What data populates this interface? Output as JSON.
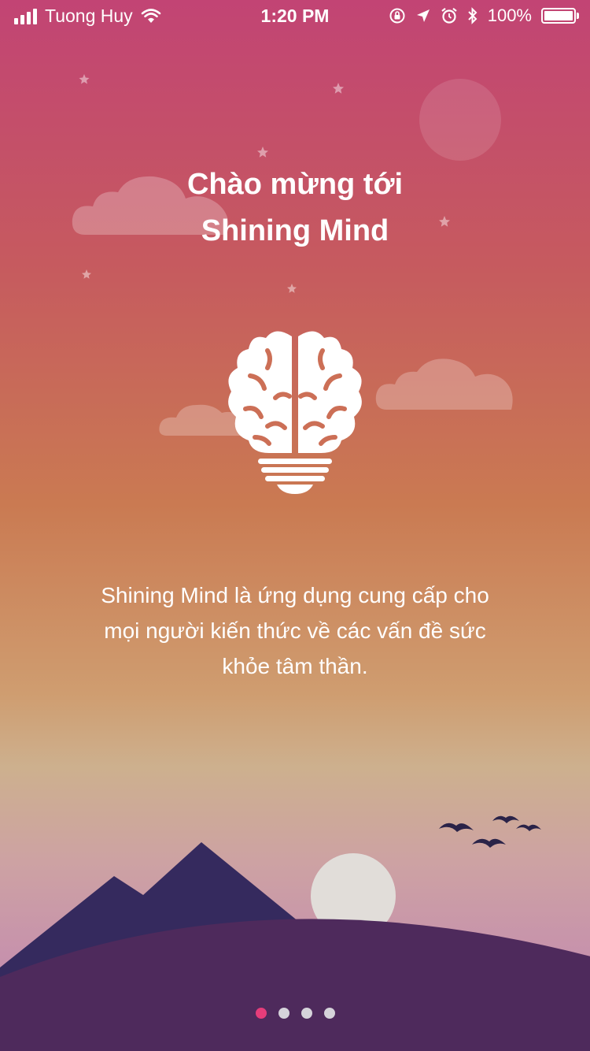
{
  "status_bar": {
    "carrier": "Tuong Huy",
    "time": "1:20 PM",
    "battery_percent": "100%",
    "battery_level": 1.0,
    "icons": [
      "signal-icon",
      "wifi-icon",
      "rotation-lock-icon",
      "location-icon",
      "alarm-icon",
      "bluetooth-icon",
      "battery-icon"
    ]
  },
  "onboarding": {
    "title_line1": "Chào mừng tới",
    "title_line2": "Shining Mind",
    "description_line1": "Shining Mind là ứng dụng cung cấp cho",
    "description_line2": "mọi người kiến thức về các vấn đề sức",
    "description_line3": "khỏe tâm thần.",
    "illustration_icon": "brain-lightbulb-icon"
  },
  "pagination": {
    "total": 4,
    "active_index": 0
  },
  "colors": {
    "gradient_top": "#c24474",
    "gradient_middle": "#ca7a52",
    "gradient_bottom": "#c690ad",
    "mountain": "#352a5e",
    "hill": "#4e2a5c",
    "active_dot": "#e53d7a",
    "inactive_dot": "#d5d3da"
  }
}
